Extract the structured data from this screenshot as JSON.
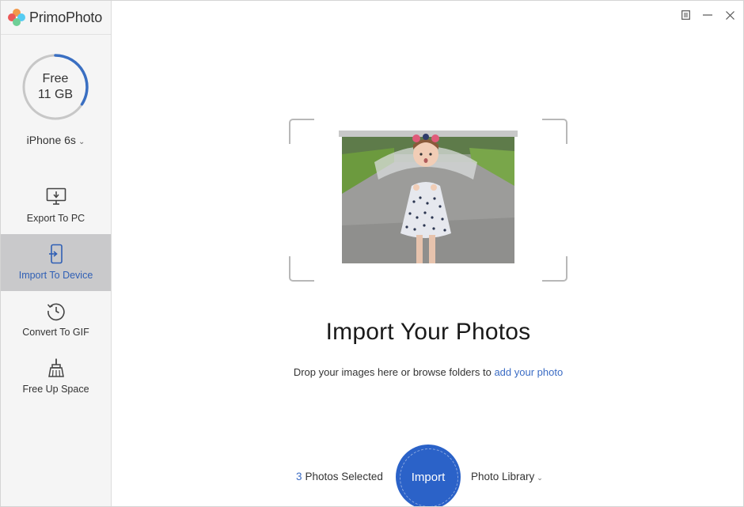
{
  "app": {
    "name": "PrimoPhoto"
  },
  "colors": {
    "accent": "#2b62c8",
    "link": "#3b6cc4",
    "sidebar_bg": "#f5f5f5",
    "active_item_bg": "#c9c9cb",
    "ring_used": "#3a6fc2",
    "ring_track": "#c7c7c7"
  },
  "storage": {
    "line1": "Free",
    "line2": "11 GB"
  },
  "device": {
    "name": "iPhone 6s",
    "chevron": "⌄"
  },
  "sidebar": {
    "items": [
      {
        "label": "Export To PC",
        "icon": "monitor-download-icon",
        "active": false
      },
      {
        "label": "Import To Device",
        "icon": "phone-import-icon",
        "active": true
      },
      {
        "label": "Convert To GIF",
        "icon": "history-clock-icon",
        "active": false
      },
      {
        "label": "Free Up Space",
        "icon": "broom-icon",
        "active": false
      }
    ]
  },
  "window_controls": [
    {
      "icon": "menu-icon"
    },
    {
      "icon": "minimize-icon"
    },
    {
      "icon": "close-icon"
    }
  ],
  "main": {
    "title": "Import Your Photos",
    "subtitle_prefix": "Drop your images here or browse folders to ",
    "subtitle_link": "add your photo"
  },
  "bottom": {
    "selected_count": "3",
    "selected_label": "Photos Selected",
    "import_label": "Import",
    "library_label": "Photo Library",
    "library_chevron": "⌄"
  }
}
